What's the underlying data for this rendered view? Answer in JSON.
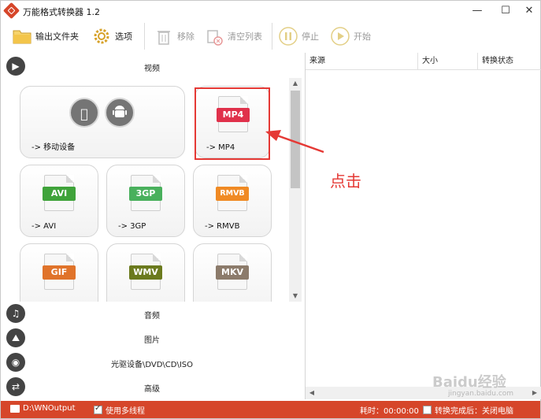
{
  "app": {
    "title": "万能格式转换器 1.2",
    "window_controls": {
      "minimize": "—",
      "maximize": "☐",
      "close": "✕"
    }
  },
  "toolbar": {
    "output_folder": "输出文件夹",
    "options": "选项",
    "remove": "移除",
    "clear_list": "清空列表",
    "stop": "停止",
    "start": "开始"
  },
  "categories": {
    "video": "视频",
    "audio": "音频",
    "image": "图片",
    "disc": "光驱设备\\DVD\\CD\\ISO",
    "advanced": "高级"
  },
  "formats": [
    {
      "badge": "",
      "label": "-> 移动设备"
    },
    {
      "badge": "MP4",
      "label": "-> MP4",
      "color": "#e0314b"
    },
    {
      "badge": "AVI",
      "label": "-> AVI",
      "color": "#3fa33a"
    },
    {
      "badge": "3GP",
      "label": "-> 3GP",
      "color": "#49b05c"
    },
    {
      "badge": "RMVB",
      "label": "-> RMVB",
      "color": "#f08a24"
    },
    {
      "badge": "GIF",
      "label": "",
      "color": "#e0732a"
    },
    {
      "badge": "WMV",
      "label": "",
      "color": "#6b7a1d"
    },
    {
      "badge": "MKV",
      "label": "",
      "color": "#8c7b6b"
    }
  ],
  "list_columns": {
    "source": "来源",
    "size": "大小",
    "status": "转换状态"
  },
  "annotation": "点击",
  "statusbar": {
    "output_path": "D:\\WNOutput",
    "multithread": "使用多线程",
    "elapsed": "耗时：00:00:00",
    "after_convert": "转换完成后：关闭电脑"
  },
  "watermark": {
    "main": "Baidu经验",
    "sub": "jingyan.baidu.com"
  },
  "colors": {
    "accent": "#d6462a",
    "highlight": "#e53935"
  }
}
